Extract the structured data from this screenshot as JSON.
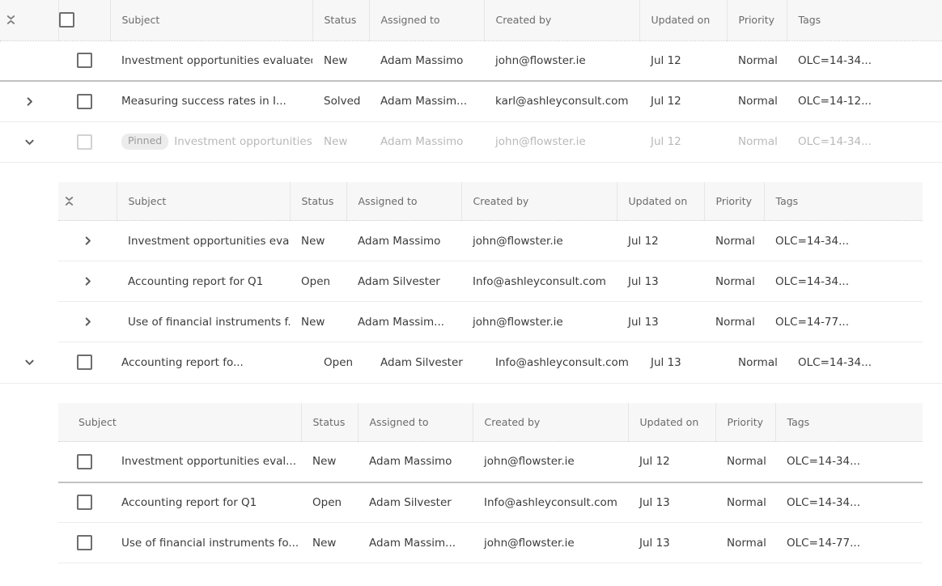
{
  "icons": {
    "collapse_all": "collapse-all-icon",
    "chevron_right": "chevron-right-icon",
    "chevron_down": "chevron-down-icon",
    "checkbox": "checkbox-icon"
  },
  "colors": {
    "header_bg": "#f7f7f7",
    "header_text": "#6b6b6b",
    "body_text": "#3b3b3b",
    "muted_text": "#b9b9b9",
    "badge_bg": "#ececec",
    "row_divider_light": "#ededed",
    "row_divider_strong": "#c2c2c2"
  },
  "columns": {
    "subject": "Subject",
    "status": "Status",
    "assigned_to": "Assigned to",
    "created_by": "Created by",
    "updated_on": "Updated on",
    "priority": "Priority",
    "tags": "Tags"
  },
  "level0": {
    "headers": {
      "subject": "Subject",
      "status": "Status",
      "assigned_to": "Assigned to",
      "created_by": "Created by",
      "updated_on": "Updated on",
      "priority": "Priority",
      "tags": "Tags"
    },
    "rows": [
      {
        "expander": "none",
        "checkbox": true,
        "pinned": "",
        "subject": "Investment opportunities evaluated",
        "status": "New",
        "assigned_to": "Adam Massimo",
        "created_by": "john@flowster.ie",
        "updated_on": "Jul 12",
        "priority": "Normal",
        "tags": "OLC=14-34...",
        "muted": false
      },
      {
        "expander": "collapsed",
        "checkbox": true,
        "pinned": "",
        "subject": "Measuring success rates in I...",
        "status": "Solved",
        "assigned_to": "Adam Massim...",
        "created_by": "karl@ashleyconsult.com",
        "updated_on": "Jul 12",
        "priority": "Normal",
        "tags": "OLC=14-12...",
        "muted": false
      },
      {
        "expander": "expanded",
        "checkbox": true,
        "pinned": "Pinned",
        "subject": "Investment opportunities...",
        "status": "New",
        "assigned_to": "Adam Massimo",
        "created_by": "john@flowster.ie",
        "updated_on": "Jul 12",
        "priority": "Normal",
        "tags": "OLC=14-34...",
        "muted": true
      },
      {
        "expander": "expanded",
        "checkbox": true,
        "pinned": "",
        "subject": "Accounting report fo...",
        "status": "Open",
        "assigned_to": "Adam Silvester",
        "created_by": "Info@ashleyconsult.com",
        "updated_on": "Jul 13",
        "priority": "Normal",
        "tags": "OLC=14-34...",
        "muted": false
      }
    ]
  },
  "nested1": {
    "headers": {
      "subject": "Subject",
      "status": "Status",
      "assigned_to": "Assigned to",
      "created_by": "Created by",
      "updated_on": "Updated on",
      "priority": "Priority",
      "tags": "Tags"
    },
    "rows": [
      {
        "expander": "collapsed",
        "subject": "Investment opportunities eva...",
        "status": "New",
        "assigned_to": "Adam Massimo",
        "created_by": "john@flowster.ie",
        "updated_on": "Jul 12",
        "priority": "Normal",
        "tags": "OLC=14-34..."
      },
      {
        "expander": "collapsed",
        "subject": "Accounting report for Q1",
        "status": "Open",
        "assigned_to": "Adam Silvester",
        "created_by": "Info@ashleyconsult.com",
        "updated_on": "Jul 13",
        "priority": "Normal",
        "tags": "OLC=14-34..."
      },
      {
        "expander": "collapsed",
        "subject": "Use of financial instruments f...",
        "status": "New",
        "assigned_to": "Adam Massim...",
        "created_by": "john@flowster.ie",
        "updated_on": "Jul 13",
        "priority": "Normal",
        "tags": "OLC=14-77..."
      }
    ]
  },
  "nested2": {
    "headers": {
      "subject": "Subject",
      "status": "Status",
      "assigned_to": "Assigned to",
      "created_by": "Created by",
      "updated_on": "Updated on",
      "priority": "Priority",
      "tags": "Tags"
    },
    "rows": [
      {
        "checkbox": true,
        "subject": "Investment opportunities eval...",
        "status": "New",
        "assigned_to": "Adam Massimo",
        "created_by": "john@flowster.ie",
        "updated_on": "Jul 12",
        "priority": "Normal",
        "tags": "OLC=14-34..."
      },
      {
        "checkbox": true,
        "subject": "Accounting report for Q1",
        "status": "Open",
        "assigned_to": "Adam Silvester",
        "created_by": "Info@ashleyconsult.com",
        "updated_on": "Jul 13",
        "priority": "Normal",
        "tags": "OLC=14-34..."
      },
      {
        "checkbox": true,
        "subject": "Use of financial instruments fo...",
        "status": "New",
        "assigned_to": "Adam Massim...",
        "created_by": "john@flowster.ie",
        "updated_on": "Jul 13",
        "priority": "Normal",
        "tags": "OLC=14-77..."
      }
    ]
  }
}
